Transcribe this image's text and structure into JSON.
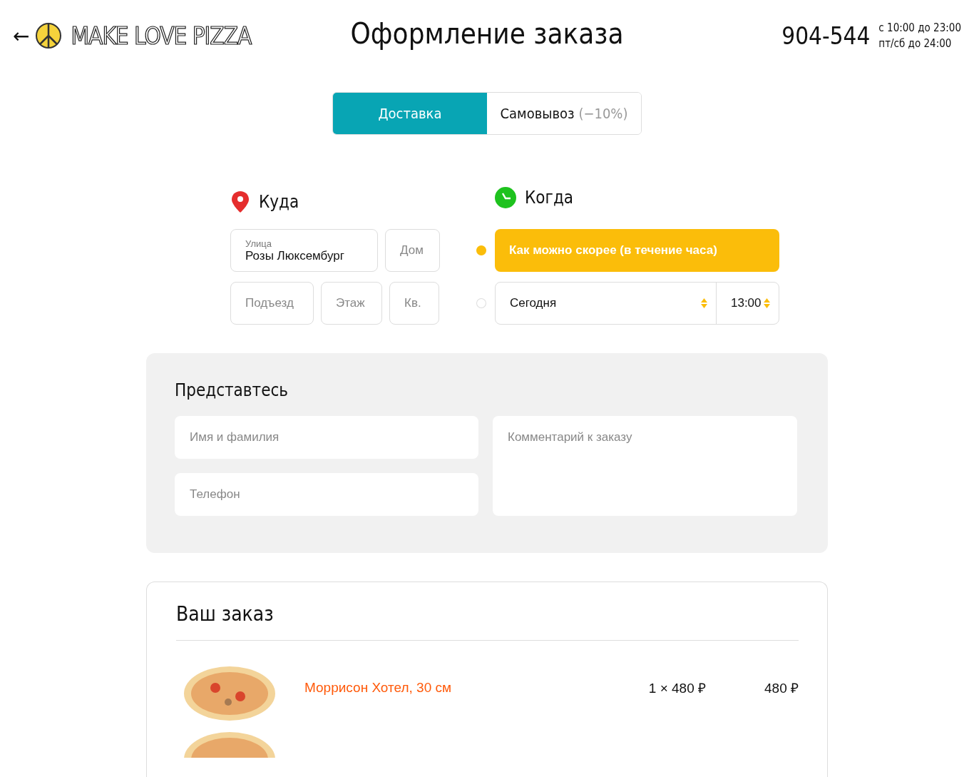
{
  "header": {
    "back": "←",
    "logo": "MAKE LOVE PIZZA",
    "title": "Оформление заказа",
    "phone": "904-544",
    "hours": [
      "с 10:00 до 23:00",
      "пт/сб до 24:00"
    ]
  },
  "tabs": [
    {
      "label": "Доставка",
      "selected": true
    },
    {
      "label": "Самовывоз",
      "note": "(−10%)",
      "selected": false
    }
  ],
  "where": {
    "title": "Куда",
    "street": {
      "label": "Улица",
      "value": "Розы Люксембург"
    },
    "house": {
      "placeholder": "Дом"
    },
    "entrance": {
      "placeholder": "Подъезд"
    },
    "floor": {
      "placeholder": "Этаж"
    },
    "flat": {
      "placeholder": "Кв."
    }
  },
  "when": {
    "title": "Когда",
    "options": [
      {
        "kind": "asap",
        "label": "Как можно скорее (в течение часа)",
        "selected": true
      },
      {
        "kind": "schedule",
        "day": "Сегодня",
        "time": "13:00",
        "selected": false
      }
    ]
  },
  "intro": {
    "title": "Представтесь",
    "name": {
      "placeholder": "Имя и фамилия"
    },
    "phone": {
      "placeholder": "Телефон"
    },
    "comment": {
      "placeholder": "Комментарий к заказу"
    }
  },
  "order": {
    "title": "Ваш заказ",
    "items": [
      {
        "kind": "full",
        "name": "Моррисон Хотел, 30 см",
        "quantity": "1 × 480 ₽",
        "total": "480 ₽"
      },
      {
        "kind": "image-only"
      }
    ]
  }
}
